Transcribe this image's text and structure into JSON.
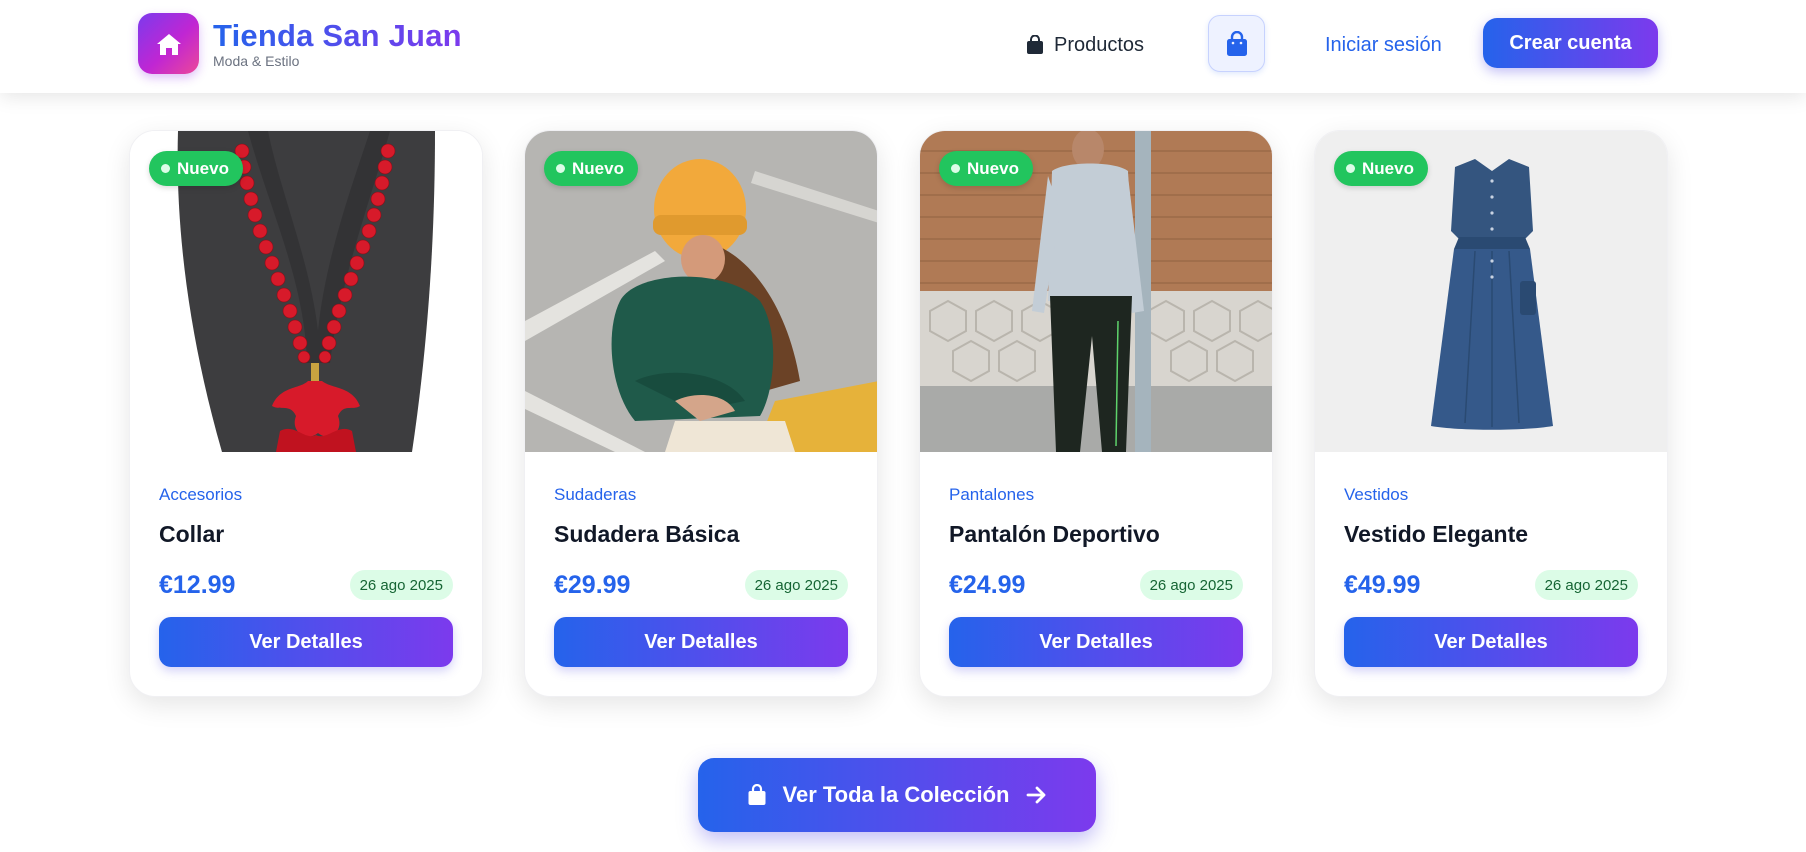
{
  "header": {
    "brand_title": "Tienda San Juan",
    "brand_subtitle": "Moda & Estilo",
    "nav_products": "Productos",
    "login": "Iniciar sesión",
    "signup": "Crear cuenta",
    "icons": {
      "logo": "home-icon",
      "products": "shopping-bag-icon",
      "cart": "shopping-bag-icon"
    }
  },
  "colors": {
    "accent_start": "#2563eb",
    "accent_end": "#7c3aed",
    "badge_green": "#22c55e",
    "date_bg": "#dcfce7"
  },
  "products": [
    {
      "badge": "Nuevo",
      "category": "Accesorios",
      "name": "Collar",
      "price": "€12.99",
      "date": "26 ago 2025",
      "button": "Ver Detalles"
    },
    {
      "badge": "Nuevo",
      "category": "Sudaderas",
      "name": "Sudadera Básica",
      "price": "€29.99",
      "date": "26 ago 2025",
      "button": "Ver Detalles"
    },
    {
      "badge": "Nuevo",
      "category": "Pantalones",
      "name": "Pantalón Deportivo",
      "price": "€24.99",
      "date": "26 ago 2025",
      "button": "Ver Detalles"
    },
    {
      "badge": "Nuevo",
      "category": "Vestidos",
      "name": "Vestido Elegante",
      "price": "€49.99",
      "date": "26 ago 2025",
      "button": "Ver Detalles"
    }
  ],
  "collection_button": {
    "label": "Ver Toda la Colección",
    "icons": {
      "left": "shopping-bag-icon",
      "right": "arrow-right-icon"
    }
  }
}
